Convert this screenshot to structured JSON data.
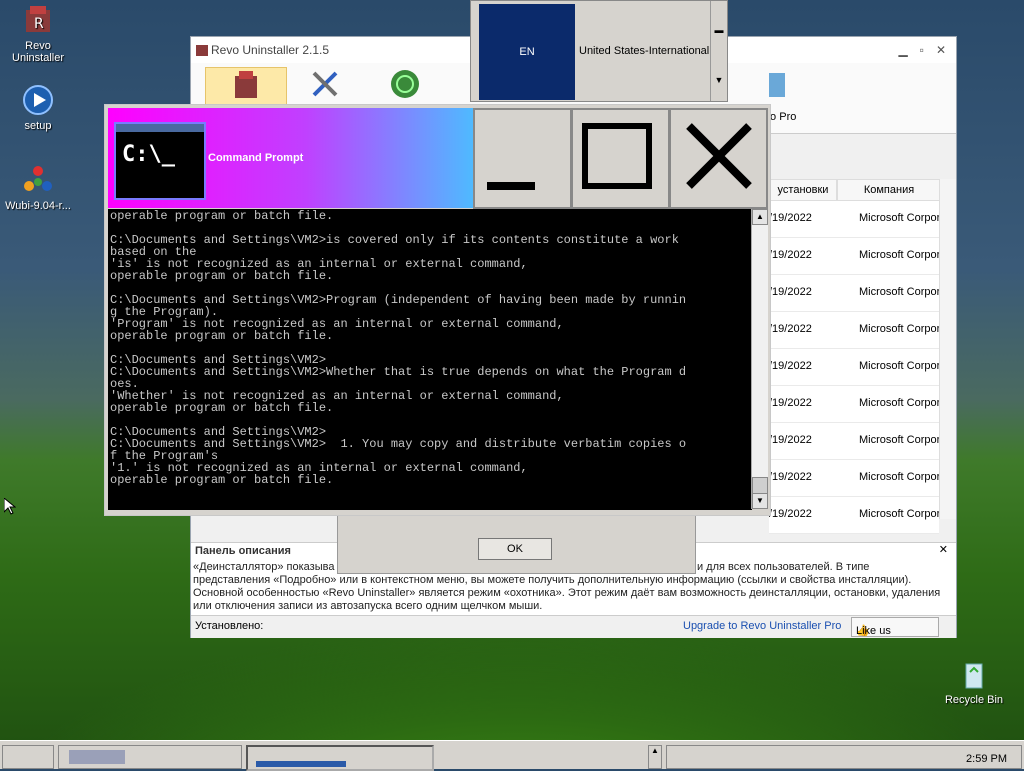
{
  "desktop": {
    "icons": [
      {
        "label": "Revo Uninstaller"
      },
      {
        "label": "setup"
      },
      {
        "label": "Wubi-9.04-r..."
      },
      {
        "label": "Recycle Bin"
      }
    ]
  },
  "revo": {
    "title": "Revo Uninstaller 2.1.5",
    "upgrade_btn": "to Pro",
    "columns": {
      "date": "установки",
      "company": "Компания"
    },
    "rows": [
      {
        "date": "/19/2022",
        "company": "Microsoft Corpor"
      },
      {
        "date": "/19/2022",
        "company": "Microsoft Corpor"
      },
      {
        "date": "/19/2022",
        "company": "Microsoft Corpor"
      },
      {
        "date": "/19/2022",
        "company": "Microsoft Corpor"
      },
      {
        "date": "/19/2022",
        "company": "Microsoft Corpor"
      },
      {
        "date": "/19/2022",
        "company": "Microsoft Corpor"
      },
      {
        "date": "/19/2022",
        "company": "Microsoft Corpor"
      },
      {
        "date": "/19/2022",
        "company": "Microsoft Corpor"
      },
      {
        "date": "/19/2022",
        "company": "Microsoft Corpor"
      }
    ],
    "desc_title": "Панель описания",
    "desc_line1_left": "«Деинсталлятор» показыва",
    "desc_line1_right": "ак и для всех пользователей. В типе",
    "desc_line2": "представления «Подробно» или в контекстном меню, вы можете получить дополнительную информацию (ссылки и свойства инсталляции).",
    "desc_line3": "Основной особенностью «Revo Uninstaller» является режим «охотника». Этот режим даёт вам возможность деинсталляции, остановки, удаления",
    "desc_line4": "или отключения записи из автозапуска всего одним щелчком мыши.",
    "status_installed": "Установлено:",
    "upgrade_link": "Upgrade to Revo Uninstaller Pro",
    "like": "Like us"
  },
  "lang": {
    "code": "EN",
    "name": "United States-International"
  },
  "dialog": {
    "ok": "OK"
  },
  "cmd": {
    "title": "Command Prompt",
    "icon_text": "C:\\_",
    "lines": [
      "operable program or batch file.",
      "",
      "C:\\Documents and Settings\\VM2>is covered only if its contents constitute a work",
      "based on the",
      "'is' is not recognized as an internal or external command,",
      "operable program or batch file.",
      "",
      "C:\\Documents and Settings\\VM2>Program (independent of having been made by runnin",
      "g the Program).",
      "'Program' is not recognized as an internal or external command,",
      "operable program or batch file.",
      "",
      "C:\\Documents and Settings\\VM2>",
      "C:\\Documents and Settings\\VM2>Whether that is true depends on what the Program d",
      "oes.",
      "'Whether' is not recognized as an internal or external command,",
      "operable program or batch file.",
      "",
      "C:\\Documents and Settings\\VM2>",
      "C:\\Documents and Settings\\VM2>  1. You may copy and distribute verbatim copies o",
      "f the Program's",
      "'1.' is not recognized as an internal or external command,",
      "operable program or batch file."
    ]
  },
  "taskbar": {
    "clock": "2:59 PM"
  }
}
